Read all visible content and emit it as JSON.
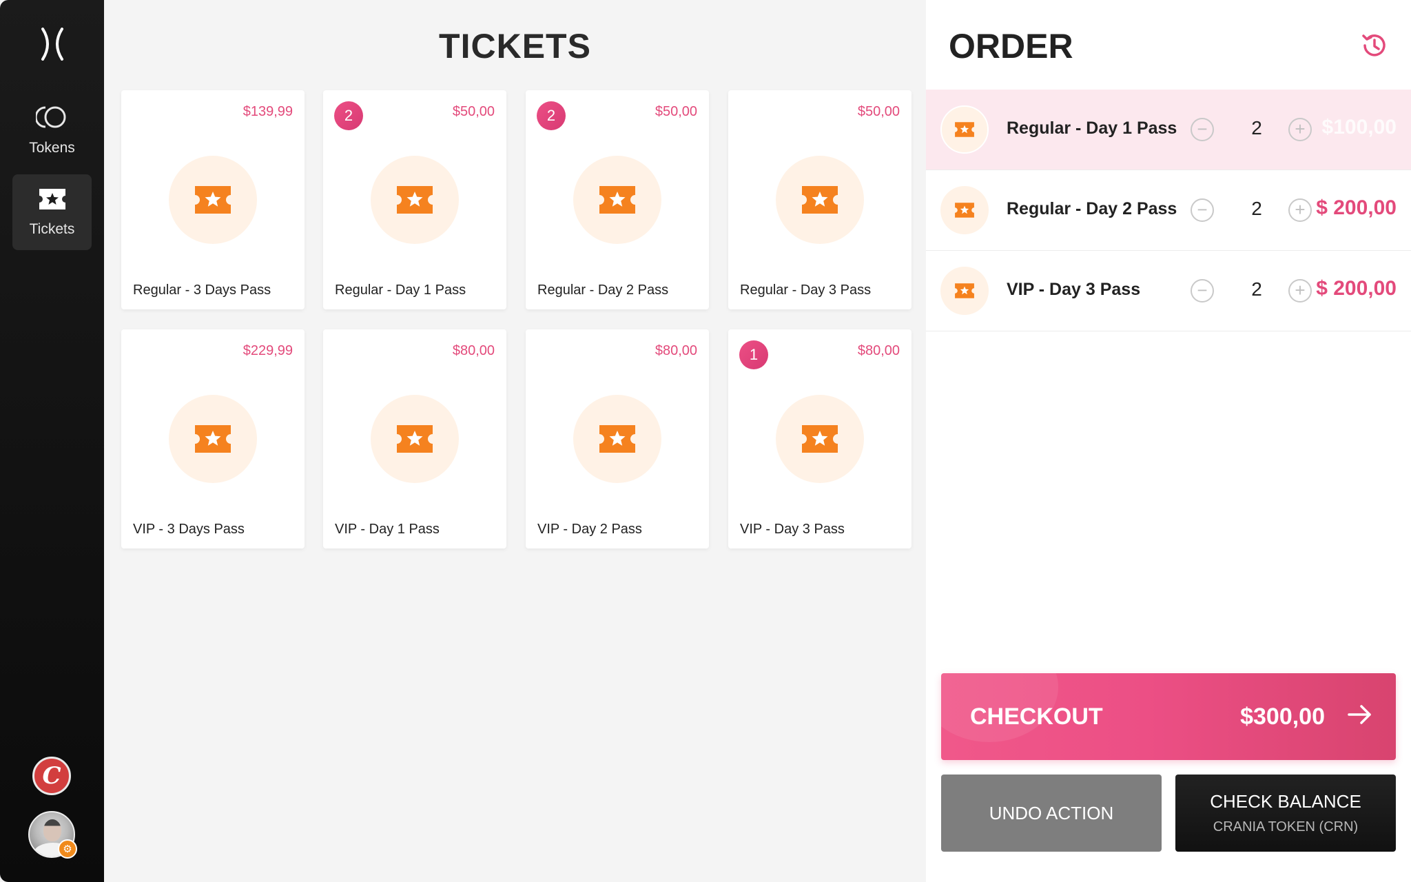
{
  "sidebar": {
    "logo_icon": "x-logo-icon",
    "items": [
      {
        "label": "Tokens",
        "icon": "tokens-icon",
        "active": false
      },
      {
        "label": "Tickets",
        "icon": "ticket-icon",
        "active": true
      }
    ],
    "crania_badge_letter": "C"
  },
  "tickets": {
    "title": "TICKETS",
    "cards": [
      {
        "name": "Regular - 3 Days Pass",
        "price": "$139,99",
        "badge": ""
      },
      {
        "name": "Regular - Day 1 Pass",
        "price": "$50,00",
        "badge": "2"
      },
      {
        "name": "Regular - Day 2 Pass",
        "price": "$50,00",
        "badge": "2"
      },
      {
        "name": "Regular - Day 3 Pass",
        "price": "$50,00",
        "badge": ""
      },
      {
        "name": "VIP - 3 Days Pass",
        "price": "$229,99",
        "badge": ""
      },
      {
        "name": "VIP - Day 1 Pass",
        "price": "$80,00",
        "badge": ""
      },
      {
        "name": "VIP - Day 2 Pass",
        "price": "$80,00",
        "badge": ""
      },
      {
        "name": "VIP - Day 3 Pass",
        "price": "$80,00",
        "badge": "1"
      }
    ]
  },
  "order": {
    "title": "ORDER",
    "history_icon": "history-icon",
    "rows": [
      {
        "name": "Regular  - Day 1 Pass",
        "qty": "2",
        "price": "$100,00",
        "highlighted": true
      },
      {
        "name": "Regular  - Day 2 Pass",
        "qty": "2",
        "price": "$ 200,00",
        "highlighted": false
      },
      {
        "name": "VIP  - Day 3 Pass",
        "qty": "2",
        "price": "$ 200,00",
        "highlighted": false
      }
    ],
    "checkout_label": "CHECKOUT",
    "checkout_total": "$300,00",
    "undo_label": "UNDO ACTION",
    "balance_label": "CHECK BALANCE",
    "balance_sub": "CRANIA TOKEN (CRN)"
  },
  "colors": {
    "accent": "#e34a7b",
    "ticket_orange": "#f5821f",
    "ticket_bg": "#fff2e6"
  }
}
